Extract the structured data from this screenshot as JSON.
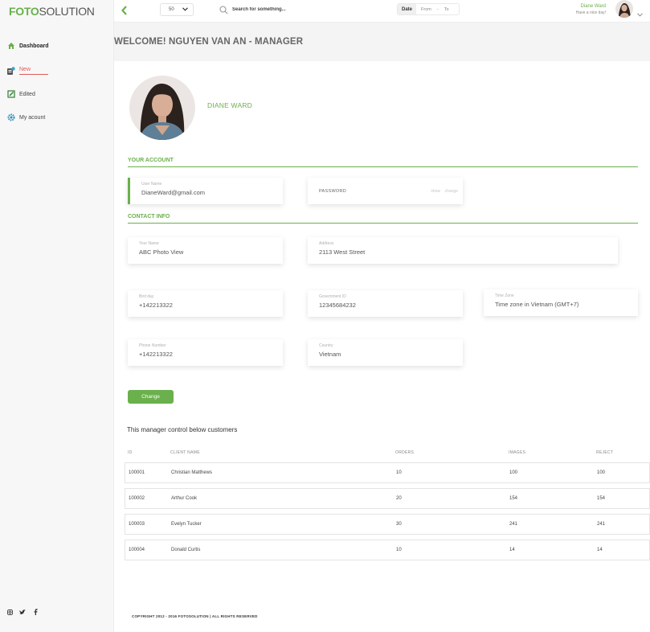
{
  "brand": {
    "part1": "FOTO",
    "part2": "SOLUTION",
    "accent": "#6ab04c"
  },
  "sidebar": {
    "items": [
      {
        "label": "Dashboard",
        "icon": "home-icon",
        "active": true
      },
      {
        "label": "New",
        "icon": "new-doc-icon"
      },
      {
        "label": "Edited",
        "icon": "edit-icon"
      },
      {
        "label": "My acount",
        "icon": "gear-icon"
      }
    ],
    "social": [
      "instagram-icon",
      "twitter-icon",
      "facebook-icon"
    ]
  },
  "topbar": {
    "per_page": "50",
    "search_placeholder": "Search for something...",
    "date_label": "Date",
    "from": "From",
    "separator": "-",
    "to": "To",
    "user_name": "Diane Ward",
    "user_greeting": "Have a nice day!"
  },
  "welcome": "WELCOME! NGUYEN VAN AN - MANAGER",
  "profile": {
    "name": "DIANE WARD"
  },
  "account": {
    "title": "YOUR ACCOUNT",
    "username_label": "User Name",
    "username_value": "DianeWard@gmail.com",
    "password_label": "PASSWORD",
    "show": "show",
    "change": "change"
  },
  "contact": {
    "title": "CONTACT INFO",
    "your_name_label": "Your Name",
    "your_name_value": "ABC Photo View",
    "address_label": "Address",
    "address_value": "2113  West Street",
    "birthday_label": "Bird day",
    "birthday_value": "+142213322",
    "gov_id_label": "Government ID",
    "gov_id_value": "12345684232",
    "timezone_label": "Time Zone",
    "timezone_value": "Time zone in Vietnam (GMT+7)",
    "phone_label": "Phone Number",
    "phone_value": "+142213322",
    "country_label": "Country",
    "country_value": "Vietnam"
  },
  "change_button": "Change",
  "table": {
    "caption": "This manager control below customers",
    "headers": [
      "ID",
      "CLIENT NAME",
      "ORDERS",
      "IMAGES",
      "REJECT"
    ],
    "rows": [
      [
        "100001",
        "Christian Matthews",
        "10",
        "100",
        "100"
      ],
      [
        "100002",
        "Arthur Cook",
        "20",
        "154",
        "154"
      ],
      [
        "100003",
        "Evelyn Tucker",
        "30",
        "241",
        "241"
      ],
      [
        "100004",
        "Donald Curtis",
        "10",
        "14",
        "14"
      ]
    ]
  },
  "footer": "COPYRIGHT 2012 - 2016 FOTOSOLUTION  |  ALL RIGHTS RESERVED"
}
